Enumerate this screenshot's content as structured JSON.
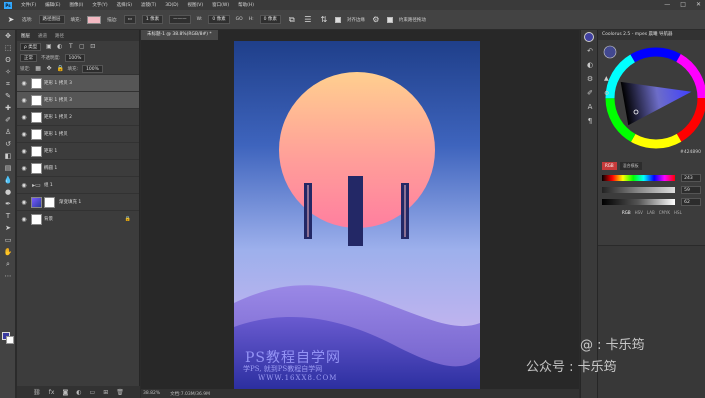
{
  "menubar": {
    "logo": "Ps",
    "items": [
      "文件(F)",
      "编辑(E)",
      "图像(I)",
      "文字(Y)",
      "选择(S)",
      "滤镜(T)",
      "3D(D)",
      "视图(V)",
      "窗口(W)",
      "帮助(H)"
    ],
    "window_buttons": [
      "—",
      "□",
      "✕"
    ]
  },
  "options": {
    "mode_label": "选项:",
    "mode_value": "路径图层",
    "fill_label": "填充:",
    "stroke_label": "描边:",
    "stroke_size": "1 像素",
    "w_label": "W:",
    "w_value": "0 像素",
    "link_icon": "GO",
    "h_label": "H:",
    "h_value": "0 像素",
    "align_edges_label": "对齐边缘",
    "constrain_label": "约束路径拖动",
    "fill_color": "#f3b9c2"
  },
  "layers_panel": {
    "tabs": [
      "图层",
      "通道",
      "路径"
    ],
    "filter_kind": "ρ 类型",
    "blend_mode": "正常",
    "opacity_label": "不透明度:",
    "opacity_value": "100%",
    "lock_label": "锁定:",
    "fill_label": "填充:",
    "fill_value": "100%",
    "layers": [
      {
        "name": "矩形 1 拷贝 3",
        "selected": true
      },
      {
        "name": "矩形 1 拷贝 3",
        "selected": true
      },
      {
        "name": "矩形 1 拷贝 2",
        "selected": false
      },
      {
        "name": "矩形 1 拷贝",
        "selected": false
      },
      {
        "name": "矩形 1",
        "selected": false
      },
      {
        "name": "椭圆 1",
        "selected": false
      },
      {
        "name": "组 1",
        "selected": false
      },
      {
        "name": "渐变填充 1",
        "selected": false
      },
      {
        "name": "背景",
        "selected": false
      }
    ]
  },
  "document": {
    "tab_title": "未标题-1 @ 38.8%(RGB/8#) *",
    "zoom": "38.82%",
    "doc_info": "文档:7.03M/36.9M"
  },
  "watermark": {
    "line1": "PS教程自学网",
    "line2": "学PS, 就到PS教程自学网",
    "line3": "WWW.16XX8.COM",
    "right1": "@ : 卡乐筠",
    "right2": "公众号 : 卡乐筠"
  },
  "color_panel": {
    "title": "Coolorus 2.5 - mpes 晨曦 导航器",
    "hex": "#424890",
    "tabs": [
      "RGB",
      "混合模板"
    ],
    "sliders": [
      {
        "label": "R",
        "value": "243"
      },
      {
        "label": "G",
        "value": "59"
      },
      {
        "label": "B",
        "value": "62"
      }
    ],
    "modes": [
      "RGB",
      "HSV",
      "LAB",
      "CMYK",
      "HSL"
    ]
  }
}
